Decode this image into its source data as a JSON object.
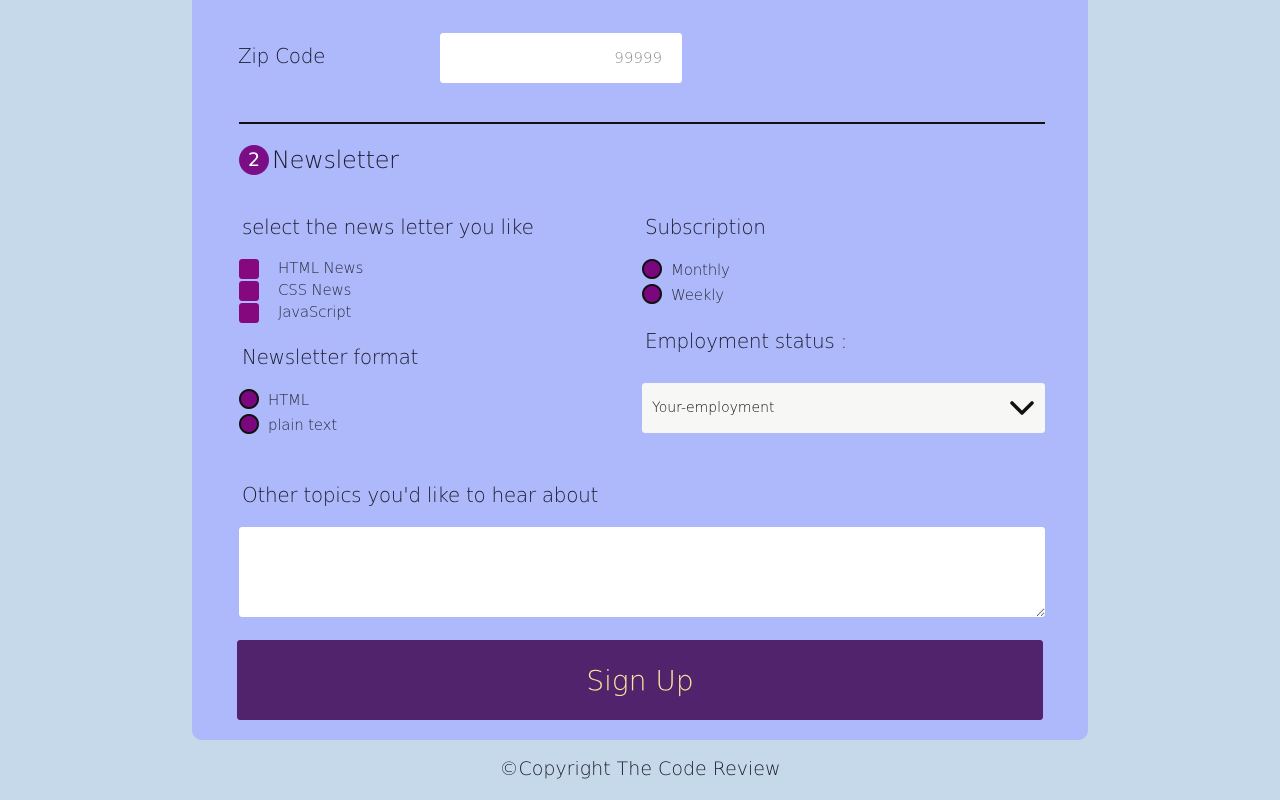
{
  "form": {
    "zip": {
      "label": "Zip Code",
      "placeholder": "99999"
    },
    "section": {
      "number": "2",
      "title": "Newsletter"
    },
    "newsletter_select": {
      "label": "select the news letter you like",
      "options": [
        "HTML News",
        "CSS News",
        "JavaScript"
      ]
    },
    "format": {
      "label": "Newsletter format",
      "options": [
        "HTML",
        "plain text"
      ]
    },
    "subscription": {
      "label": "Subscription",
      "options": [
        "Monthly",
        "Weekly"
      ]
    },
    "employment": {
      "label": "Employment status :",
      "selected": "Your-employment"
    },
    "topics": {
      "label": "Other topics you'd like to hear about"
    },
    "submit_label": "Sign Up"
  },
  "footer": {
    "copyright": "©Copyright The Code Review"
  },
  "colors": {
    "page_bg": "#c6d9ea",
    "card_bg": "#adb9fa",
    "accent_purple": "#7b0d86",
    "button_bg": "#51236d",
    "button_text": "#f4e79a"
  }
}
